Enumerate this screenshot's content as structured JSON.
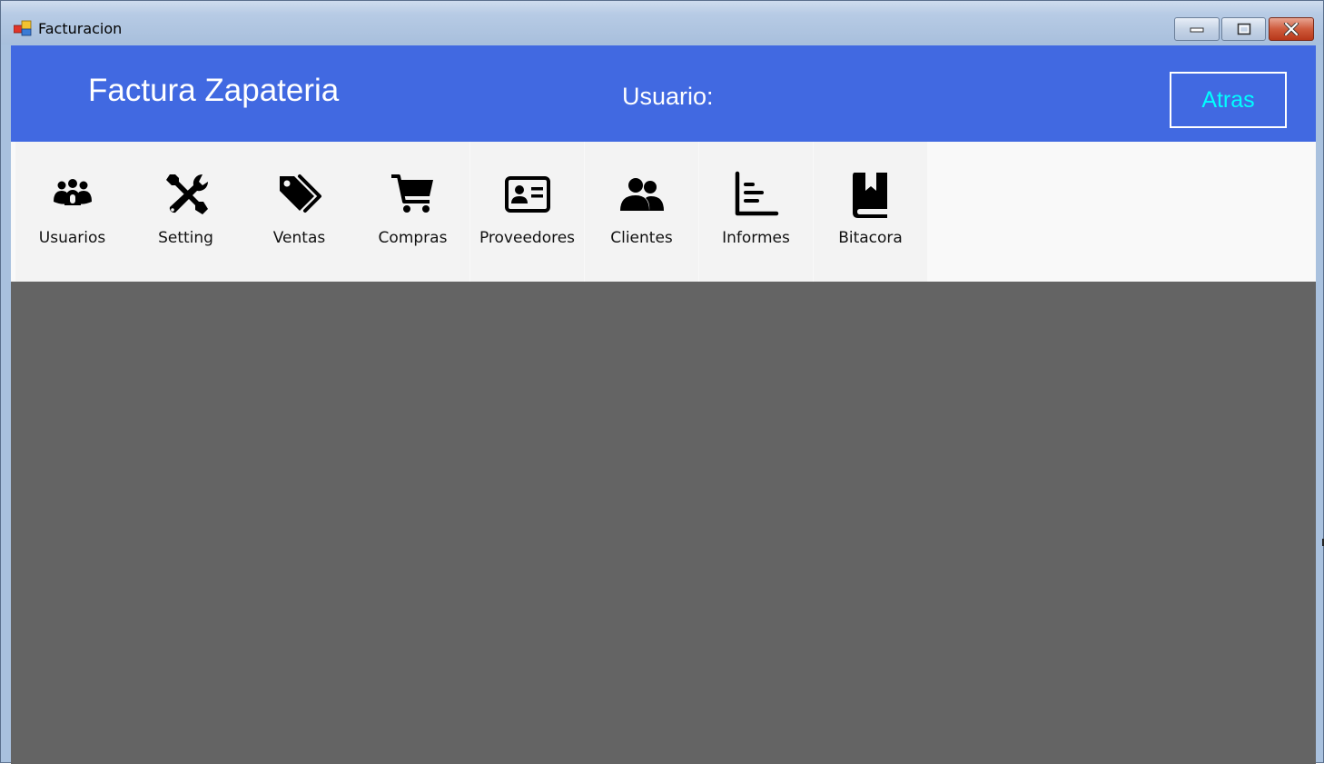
{
  "window": {
    "title": "Facturacion",
    "icon": "app-windows-icon",
    "controls": {
      "minimize_icon": "minimize-icon",
      "maximize_icon": "maximize-icon",
      "close_icon": "close-icon"
    }
  },
  "header": {
    "title": "Factura Zapateria",
    "user_label": "Usuario:",
    "back_label": "Atras",
    "background_color": "#4169e1",
    "back_text_color": "#00ffff"
  },
  "toolbar": {
    "items": [
      {
        "label": "Usuarios",
        "icon": "users-group-icon"
      },
      {
        "label": "Setting",
        "icon": "tools-icon"
      },
      {
        "label": "Ventas",
        "icon": "tags-icon"
      },
      {
        "label": "Compras",
        "icon": "shopping-cart-icon"
      },
      {
        "label": "Proveedores",
        "icon": "id-card-icon"
      },
      {
        "label": "Clientes",
        "icon": "user-friends-icon"
      },
      {
        "label": "Informes",
        "icon": "chart-bars-icon"
      },
      {
        "label": "Bitacora",
        "icon": "book-icon"
      }
    ]
  },
  "content": {
    "background_color": "#646464"
  }
}
